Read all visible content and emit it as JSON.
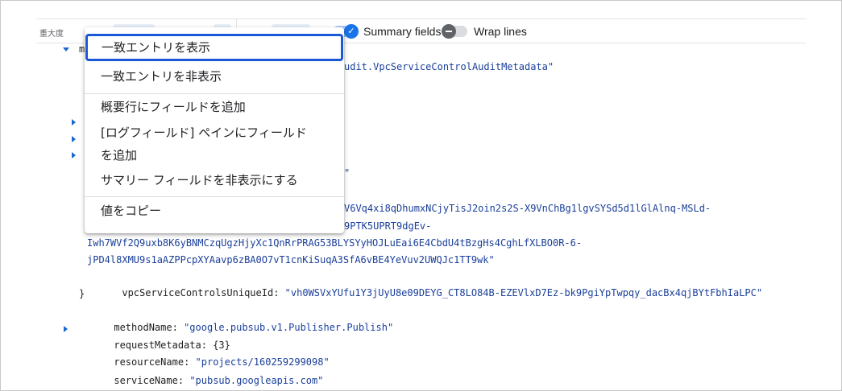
{
  "toolbar": {
    "severity_label": "重大度",
    "summary_fields_label": "Summary fields",
    "summary_fields_enabled": true,
    "wrap_lines_label": "Wrap lines",
    "wrap_lines_enabled": false
  },
  "log": {
    "collapsed_key_fragment": "m",
    "line_at_type": "udit.VpcServiceControlAuditMetadata\"",
    "line_brace_fragment": "\"",
    "line_token1": "V6Vq4xi8qDhumxNCjyTisJ2oin2s2S-X9VnChBg1lgvSYSd5d1lGlAlnq-MSLd-",
    "line_token2": "9PTK5UPRT9dgEv-",
    "line_token3": "Iwh7WVf2Q9uxb8K6yBNMCzqUgzHjyXc1QnRrPRAG53BLYSYyHOJLuEai6E4CbdU4tBzgHs4CghLfXLBO0R-6-",
    "line_token4": "jPD4l8XMU9s1aAZPPcpXYAavp6zBA0O7vT1cnKiSuqA3SfA6vBE4YeVuv2UWQJc1TT9wk\"",
    "vpc_key": "vpcServiceControlsUniqueId",
    "vpc_value": "\"vh0WSVxYUfu1Y3jUyU8e09DEYG_CT8LO84B-EZEVlxD7Ez-bk9PgiYpTwpqy_dacBx4qjBYtFbhIaLPC\"",
    "closing_brace": "}",
    "method_key": "methodName",
    "method_value": "\"google.pubsub.v1.Publisher.Publish\"",
    "request_metadata_key": "requestMetadata",
    "request_metadata_value": "{3}",
    "resource_key": "resourceName",
    "resource_value": "\"projects/160259299098\"",
    "service_key": "serviceName",
    "service_value": "\"pubsub.googleapis.com\"",
    "colon": ":"
  },
  "context_menu": {
    "items": [
      {
        "label": "一致エントリを表示"
      },
      {
        "label": "一致エントリを非表示"
      },
      {
        "label": "概要行にフィールドを追加"
      },
      {
        "label": "[ログフィールド] ペインにフィールド"
      },
      {
        "label": "を追加"
      },
      {
        "label": "サマリー フィールドを非表示にする"
      },
      {
        "label": "値をコピー"
      }
    ]
  },
  "colors": {
    "accent": "#1a73e8",
    "value_text": "#1a3f9a",
    "focus_outline": "#1a58d6"
  },
  "icons": {
    "expand": "caret-down-icon",
    "collapsed": "caret-right-icon",
    "checkmark": "check-icon"
  }
}
